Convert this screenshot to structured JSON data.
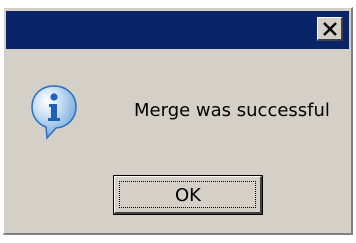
{
  "dialog": {
    "message": "Merge was successful",
    "icon": "info-icon",
    "ok_label": "OK",
    "close_icon": "close-icon"
  },
  "colors": {
    "titlebar": "#0a246a",
    "face": "#d4d0c8",
    "icon_blue": "#2a6fc4"
  }
}
